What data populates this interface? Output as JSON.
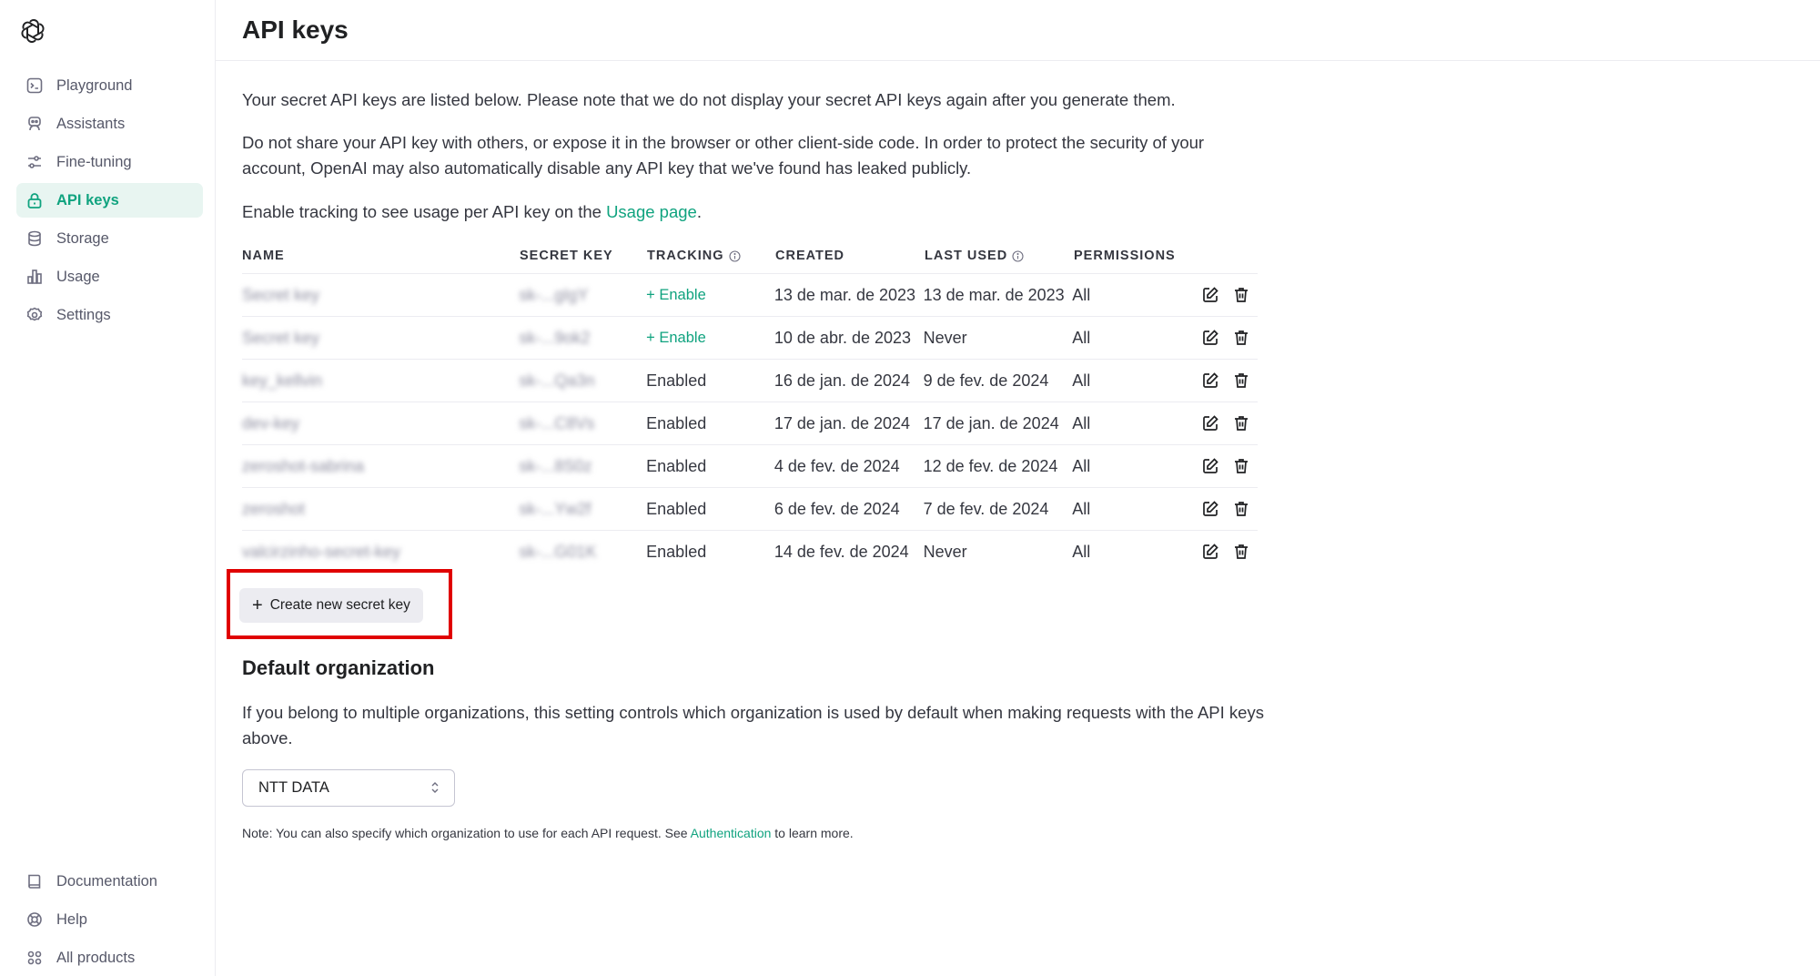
{
  "sidebar": {
    "items": [
      {
        "label": "Playground",
        "icon": "playground-icon"
      },
      {
        "label": "Assistants",
        "icon": "assistants-icon"
      },
      {
        "label": "Fine-tuning",
        "icon": "fine-tuning-icon"
      },
      {
        "label": "API keys",
        "icon": "lock-icon",
        "active": true
      },
      {
        "label": "Storage",
        "icon": "storage-icon"
      },
      {
        "label": "Usage",
        "icon": "usage-icon"
      },
      {
        "label": "Settings",
        "icon": "gear-icon"
      }
    ],
    "bottom": [
      {
        "label": "Documentation",
        "icon": "book-icon"
      },
      {
        "label": "Help",
        "icon": "help-icon"
      },
      {
        "label": "All products",
        "icon": "grid-icon"
      }
    ]
  },
  "header": {
    "title": "API keys"
  },
  "main": {
    "intro": "Your secret API keys are listed below. Please note that we do not display your secret API keys again after you generate them.",
    "warning": "Do not share your API key with others, or expose it in the browser or other client-side code. In order to protect the security of your account, OpenAI may also automatically disable any API key that we've found has leaked publicly.",
    "tracking_prefix": "Enable tracking to see usage per API key on the ",
    "tracking_link": "Usage page",
    "tracking_suffix": ".",
    "table": {
      "headers": {
        "name": "NAME",
        "secret_key": "SECRET KEY",
        "tracking": "TRACKING",
        "created": "CREATED",
        "last_used": "LAST USED",
        "permissions": "PERMISSIONS"
      },
      "rows": [
        {
          "name": "Secret key",
          "secret_key": "sk-...gIgY",
          "tracking": "+ Enable",
          "created": "13 de mar. de 2023",
          "last_used": "13 de mar. de 2023",
          "permissions": "All"
        },
        {
          "name": "Secret key",
          "secret_key": "sk-...9ok2",
          "tracking": "+ Enable",
          "created": "10 de abr. de 2023",
          "last_used": "Never",
          "permissions": "All"
        },
        {
          "name": "key_kellvin",
          "secret_key": "sk-...Qa3n",
          "tracking": "Enabled",
          "created": "16 de jan. de 2024",
          "last_used": "9 de fev. de 2024",
          "permissions": "All"
        },
        {
          "name": "dev-key",
          "secret_key": "sk-...C8Vs",
          "tracking": "Enabled",
          "created": "17 de jan. de 2024",
          "last_used": "17 de jan. de 2024",
          "permissions": "All"
        },
        {
          "name": "zeroshot-sabrina",
          "secret_key": "sk-...8S0z",
          "tracking": "Enabled",
          "created": "4 de fev. de 2024",
          "last_used": "12 de fev. de 2024",
          "permissions": "All"
        },
        {
          "name": "zeroshot",
          "secret_key": "sk-...Yw2f",
          "tracking": "Enabled",
          "created": "6 de fev. de 2024",
          "last_used": "7 de fev. de 2024",
          "permissions": "All"
        },
        {
          "name": "valcirzinho-secret-key",
          "secret_key": "sk-...G01K",
          "tracking": "Enabled",
          "created": "14 de fev. de 2024",
          "last_used": "Never",
          "permissions": "All"
        }
      ]
    },
    "create_button": "Create new secret key",
    "default_org_title": "Default organization",
    "default_org_desc": "If you belong to multiple organizations, this setting controls which organization is used by default when making requests with the API keys above.",
    "org_select_value": "NTT DATA",
    "note_prefix": "Note: You can also specify which organization to use for each API request. See ",
    "note_link": "Authentication",
    "note_suffix": " to learn more."
  },
  "colors": {
    "accent": "#10a37f",
    "highlight_box": "#e00000",
    "active_bg": "#e8f5f1"
  }
}
